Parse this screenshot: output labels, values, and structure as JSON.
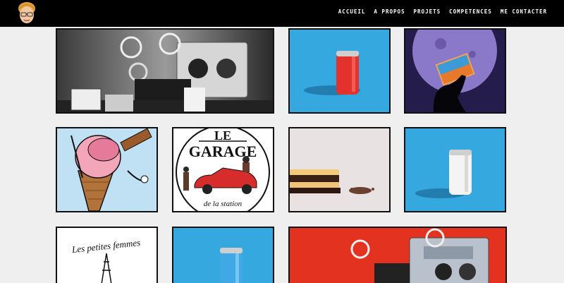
{
  "nav": {
    "items": [
      "ACCUEIL",
      "A PROPOS",
      "PROJETS",
      "COMPETENCES",
      "ME CONTACTER"
    ]
  },
  "portfolio": {
    "garage_logo": {
      "line1": "LE",
      "line2": "GARAGE",
      "line3": "de la station"
    },
    "femmes_poster": {
      "title": "Les petites femmes"
    }
  },
  "colors": {
    "navbar": "#000000",
    "page_bg": "#efefef",
    "sky_blue": "#35a8e0",
    "red_bg": "#e3321f"
  }
}
